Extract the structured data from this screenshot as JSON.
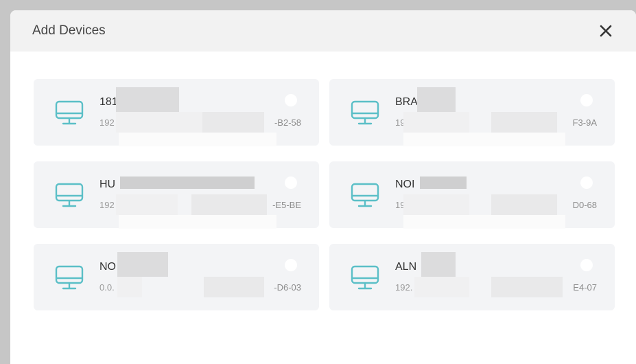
{
  "dialog": {
    "title": "Add Devices",
    "close_icon": "close-icon"
  },
  "accent_color": "#5bbfc7",
  "devices": [
    {
      "name": "181",
      "ip": "192",
      "mac": "-B2-58",
      "icon": "monitor-icon",
      "selected": false
    },
    {
      "name": "BRA",
      "ip": "192",
      "mac": "F3-9A",
      "icon": "monitor-icon",
      "selected": false
    },
    {
      "name": "HU",
      "ip": "192",
      "mac": "-E5-BE",
      "icon": "monitor-icon",
      "selected": false
    },
    {
      "name": "NOI",
      "ip": "192",
      "mac": "D0-68",
      "icon": "monitor-icon",
      "selected": false
    },
    {
      "name": "NO",
      "ip": "0.0.",
      "mac": "-D6-03",
      "icon": "monitor-icon",
      "selected": false
    },
    {
      "name": "ALN",
      "ip": "192.",
      "mac": "E4-07",
      "icon": "monitor-icon",
      "selected": false
    }
  ]
}
